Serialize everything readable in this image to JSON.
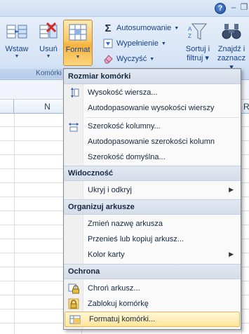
{
  "ribbon": {
    "cells_group_label": "Komórki",
    "insert_label": "Wstaw",
    "delete_label": "Usuń",
    "format_label": "Format",
    "autosum_label": "Autosumowanie",
    "fill_label": "Wypełnienie",
    "clear_label": "Wyczyść",
    "sort_label_1": "Sortuj i",
    "sort_label_2": "filtruj",
    "find_label_1": "Znajdź i",
    "find_label_2": "zaznacz"
  },
  "sheet": {
    "visible_column": "N",
    "partial_column": "R"
  },
  "menu": {
    "sections": [
      {
        "header": "Rozmiar komórki",
        "items": [
          {
            "label": "Wysokość wiersza...",
            "icon": "row-height-icon"
          },
          {
            "label": "Autodopasowanie wysokości wierszy",
            "icon": ""
          },
          {
            "label": "Szerokość kolumny...",
            "icon": "column-width-icon"
          },
          {
            "label": "Autodopasowanie szerokości kolumn",
            "icon": ""
          },
          {
            "label": "Szerokość domyślna...",
            "icon": ""
          }
        ]
      },
      {
        "header": "Widoczność",
        "items": [
          {
            "label": "Ukryj i odkryj",
            "icon": "",
            "submenu": true
          }
        ]
      },
      {
        "header": "Organizuj arkusze",
        "items": [
          {
            "label": "Zmień nazwę arkusza",
            "icon": ""
          },
          {
            "label": "Przenieś lub kopiuj arkusz...",
            "icon": ""
          },
          {
            "label": "Kolor karty",
            "icon": "",
            "submenu": true
          }
        ]
      },
      {
        "header": "Ochrona",
        "items": [
          {
            "label": "Chroń arkusz...",
            "icon": "protect-sheet-icon"
          },
          {
            "label": "Zablokuj komórkę",
            "icon": "lock-cell-icon"
          },
          {
            "label": "Formatuj komórki...",
            "icon": "format-cells-icon",
            "highlighted": true
          }
        ]
      }
    ]
  },
  "colors": {
    "ribbon_text": "#15428b",
    "hover_top": "#fff6d7",
    "hover_bottom": "#ffe69a",
    "pressed": "#f9c766"
  }
}
